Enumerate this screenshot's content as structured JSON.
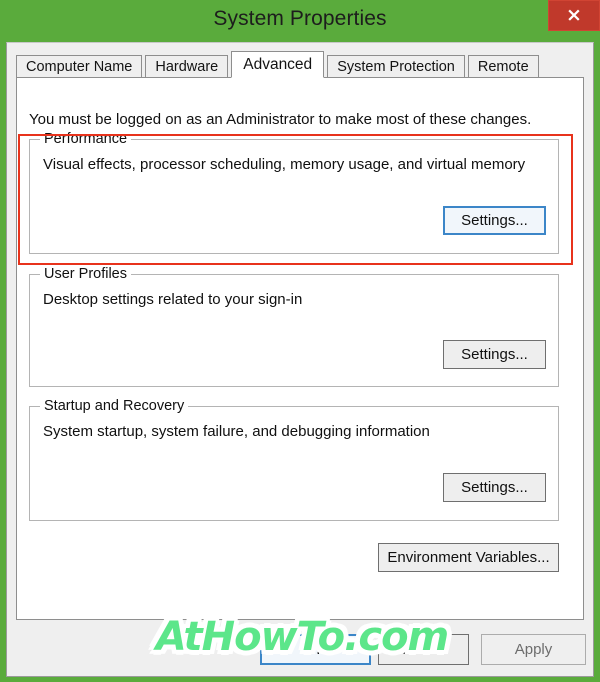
{
  "window": {
    "title": "System Properties",
    "close_label": "×",
    "chrome_color": "#5aab3c",
    "close_color": "#c0392b"
  },
  "tabs": [
    {
      "label": "Computer Name",
      "selected": false
    },
    {
      "label": "Hardware",
      "selected": false
    },
    {
      "label": "Advanced",
      "selected": true
    },
    {
      "label": "System Protection",
      "selected": false
    },
    {
      "label": "Remote",
      "selected": false
    }
  ],
  "page": {
    "admin_note": "You must be logged on as an Administrator to make most of these changes.",
    "groups": [
      {
        "legend": "Performance",
        "description": "Visual effects, processor scheduling, memory usage, and virtual memory",
        "button_label": "Settings...",
        "button_focused": true,
        "highlighted": true
      },
      {
        "legend": "User Profiles",
        "description": "Desktop settings related to your sign-in",
        "button_label": "Settings...",
        "button_focused": false,
        "highlighted": false
      },
      {
        "legend": "Startup and Recovery",
        "description": "System startup, system failure, and debugging information",
        "button_label": "Settings...",
        "button_focused": false,
        "highlighted": false
      }
    ],
    "environment_button_label": "Environment Variables..."
  },
  "dialog_buttons": {
    "ok_label": "OK",
    "cancel_label": "Cancel",
    "apply_label": "Apply"
  },
  "annotation": {
    "highlight_color": "#e8331c"
  },
  "watermark": {
    "text": "AtHowTo.com",
    "color": "#5ce68a"
  }
}
